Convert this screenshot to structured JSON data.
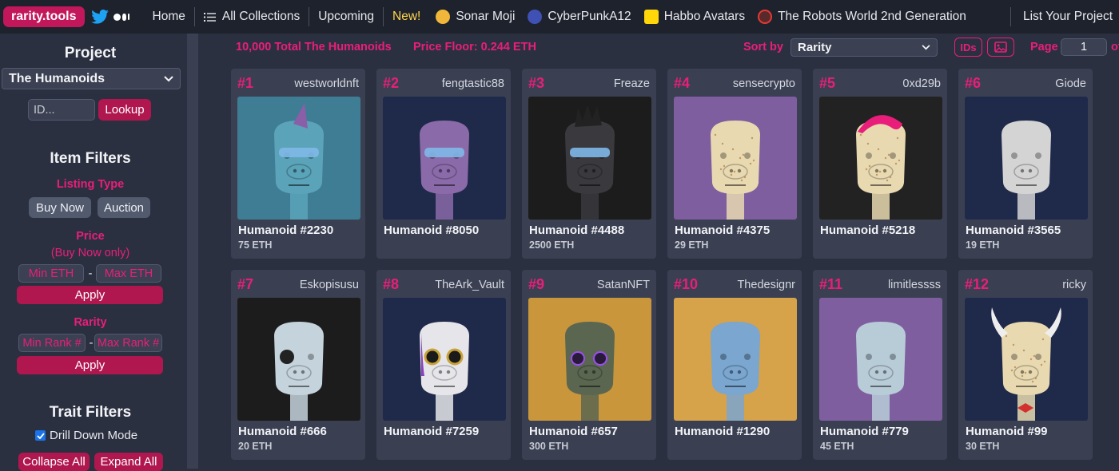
{
  "nav": {
    "brand": "rarity.tools",
    "home": "Home",
    "all_collections": "All Collections",
    "upcoming": "Upcoming",
    "new_label": "New!",
    "projects": [
      {
        "label": "Sonar Moji",
        "color": "#f0b73a"
      },
      {
        "label": "CyberPunkA12",
        "color": "#3f51b5"
      },
      {
        "label": "Habbo Avatars",
        "color": "#ffd60a"
      },
      {
        "label": "The Robots World 2nd Generation",
        "color": "#e53935"
      }
    ],
    "list_project": "List Your Project"
  },
  "sidebar": {
    "project_heading": "Project",
    "project_selected": "The Humanoids",
    "id_placeholder": "ID...",
    "lookup": "Lookup",
    "item_filters_heading": "Item Filters",
    "listing_type_label": "Listing Type",
    "buy_now": "Buy Now",
    "auction": "Auction",
    "price_label": "Price",
    "price_note": "(Buy Now only)",
    "min_eth": "Min ETH",
    "max_eth": "Max ETH",
    "dash": "-",
    "apply": "Apply",
    "rarity_label": "Rarity",
    "min_rank": "Min Rank #",
    "max_rank": "Max Rank #",
    "trait_filters_heading": "Trait Filters",
    "drill_down": "Drill Down Mode",
    "collapse_all": "Collapse All",
    "expand_all": "Expand All"
  },
  "toolbar": {
    "total": "10,000 Total The Humanoids",
    "floor": "Price Floor: 0.244 ETH",
    "sort_by_label": "Sort by",
    "sort_value": "Rarity",
    "ids_label": "IDs",
    "page_label": "Page",
    "page_value": "1",
    "page_suffix": "of"
  },
  "cards": [
    {
      "rank": "#1",
      "owner": "westworldnft",
      "name": "Humanoid #2230",
      "price": "75 ETH",
      "bg": "#3f7d95",
      "skin": "#5aa3b8",
      "extra": "visor-mohawk"
    },
    {
      "rank": "#2",
      "owner": "fengtastic88",
      "name": "Humanoid #8050",
      "price": "",
      "bg": "#1f2a4a",
      "skin": "#8a6aa8",
      "extra": "visor"
    },
    {
      "rank": "#3",
      "owner": "Freaze",
      "name": "Humanoid #4488",
      "price": "2500 ETH",
      "bg": "#1c1c1c",
      "skin": "#3a3a3e",
      "extra": "visor-crown"
    },
    {
      "rank": "#4",
      "owner": "sensecrypto",
      "name": "Humanoid #4375",
      "price": "29 ETH",
      "bg": "#7f5ea0",
      "skin": "#e8d9b0",
      "extra": "speckle"
    },
    {
      "rank": "#5",
      "owner": "0xd29b",
      "name": "Humanoid #5218",
      "price": "",
      "bg": "#222222",
      "skin": "#e8d9b0",
      "extra": "pinkhair"
    },
    {
      "rank": "#6",
      "owner": "Giode",
      "name": "Humanoid #3565",
      "price": "19 ETH",
      "bg": "#1f2a4a",
      "skin": "#d4d4d4",
      "extra": "plain"
    },
    {
      "rank": "#7",
      "owner": "Eskopisusu",
      "name": "Humanoid #666",
      "price": "20 ETH",
      "bg": "#1c1c1c",
      "skin": "#c5d3dc",
      "extra": "eyepatch"
    },
    {
      "rank": "#8",
      "owner": "TheArk_Vault",
      "name": "Humanoid #7259",
      "price": "",
      "bg": "#1f2a4a",
      "skin": "#e6e6ea",
      "extra": "goggles"
    },
    {
      "rank": "#9",
      "owner": "SatanNFT",
      "name": "Humanoid #657",
      "price": "300 ETH",
      "bg": "#c9963c",
      "skin": "#5a6650",
      "extra": "sunglasses"
    },
    {
      "rank": "#10",
      "owner": "Thedesignr",
      "name": "Humanoid #1290",
      "price": "",
      "bg": "#d6a24a",
      "skin": "#7aa6cf",
      "extra": "plain"
    },
    {
      "rank": "#11",
      "owner": "limitlessss",
      "name": "Humanoid #779",
      "price": "45 ETH",
      "bg": "#7f5ea0",
      "skin": "#b8ccd8",
      "extra": "plain"
    },
    {
      "rank": "#12",
      "owner": "ricky",
      "name": "Humanoid #99",
      "price": "30 ETH",
      "bg": "#1f2a4a",
      "skin": "#e8d9b0",
      "extra": "horns"
    }
  ],
  "colors": {
    "accent": "#e91e7a",
    "brand": "#c2185b",
    "panel": "#3a4052",
    "background": "#2b3040"
  }
}
